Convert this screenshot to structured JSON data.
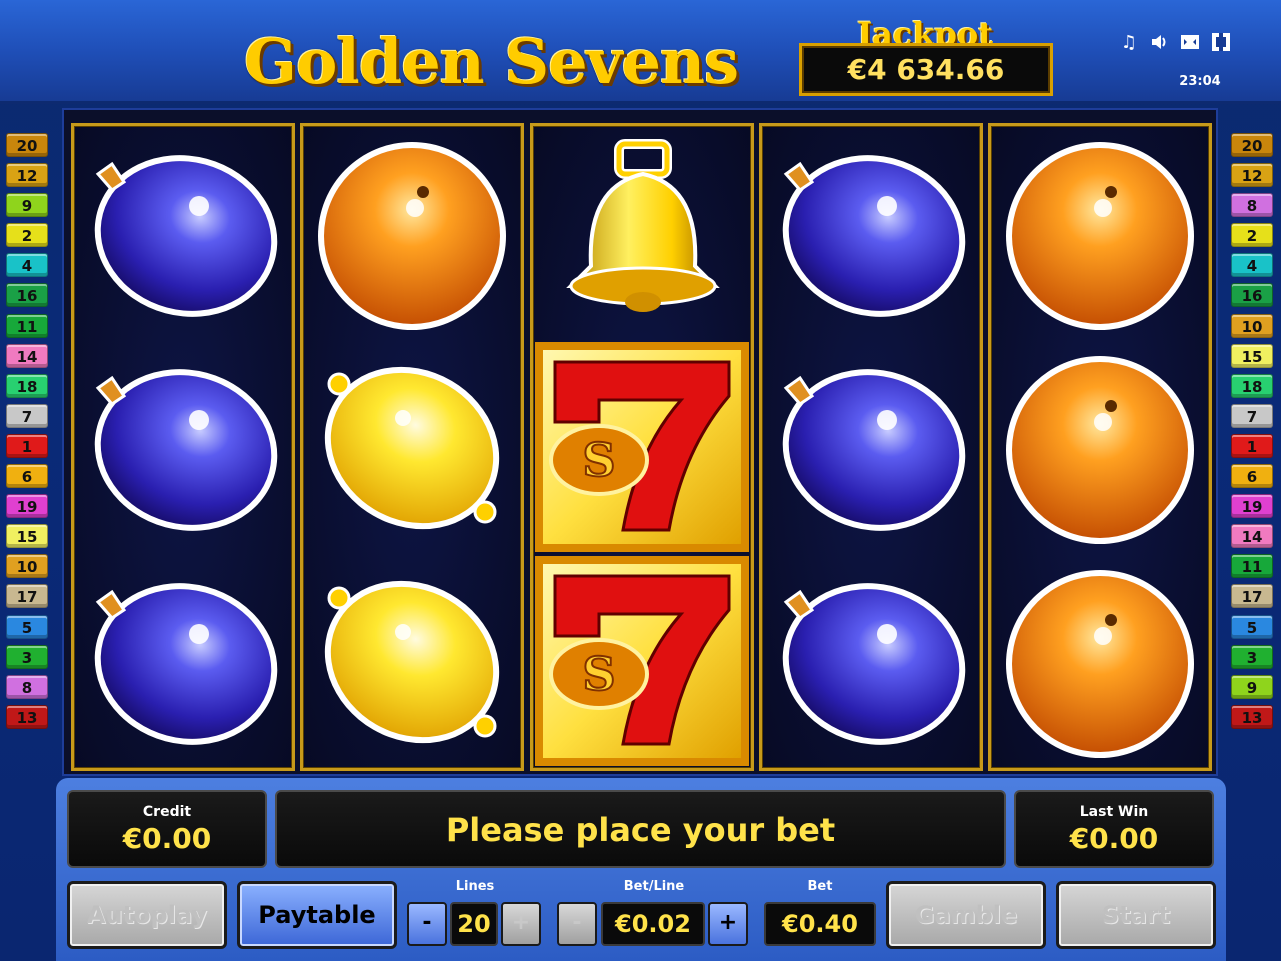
{
  "header": {
    "title": "Golden Sevens",
    "jackpot_label": "Jackpot",
    "jackpot_value": "€4 634.66",
    "clock": "23:04",
    "icons": [
      "music-icon",
      "speaker-icon",
      "fullscreen-icon",
      "settings-icon"
    ]
  },
  "paylines": {
    "left": [
      "20",
      "12",
      "9",
      "2",
      "4",
      "16",
      "11",
      "14",
      "18",
      "7",
      "1",
      "6",
      "19",
      "15",
      "10",
      "17",
      "5",
      "3",
      "8",
      "13"
    ],
    "right": [
      "20",
      "12",
      "8",
      "2",
      "4",
      "16",
      "10",
      "15",
      "18",
      "7",
      "1",
      "6",
      "19",
      "14",
      "11",
      "17",
      "5",
      "3",
      "9",
      "13"
    ],
    "colors": {
      "20": "#c9860c",
      "12": "#d9a214",
      "9": "#8fd41c",
      "2": "#e6e01a",
      "4": "#19c2c8",
      "16": "#1aa046",
      "11": "#17a83a",
      "14": "#f07ac0",
      "18": "#28d070",
      "7": "#c8c8c8",
      "1": "#e01a1a",
      "6": "#f0b010",
      "19": "#e040d0",
      "15": "#f0f060",
      "10": "#e0a020",
      "17": "#c8b890",
      "5": "#2a88e0",
      "3": "#20b030",
      "8": "#d070e0",
      "13": "#c01818"
    }
  },
  "reels": [
    [
      "plum",
      "plum",
      "plum"
    ],
    [
      "orange",
      "lemon",
      "lemon"
    ],
    [
      "bell",
      "seven",
      "seven"
    ],
    [
      "plum",
      "plum",
      "plum"
    ],
    [
      "orange",
      "orange",
      "orange"
    ]
  ],
  "panel": {
    "credit_label": "Credit",
    "credit_value": "€0.00",
    "message": "Please place your bet",
    "last_win_label": "Last Win",
    "last_win_value": "€0.00",
    "autoplay_label": "Autoplay",
    "paytable_label": "Paytable",
    "lines_label": "Lines",
    "lines_value": "20",
    "betline_label": "Bet/Line",
    "betline_value": "€0.02",
    "bet_label": "Bet",
    "bet_value": "€0.40",
    "gamble_label": "Gamble",
    "start_label": "Start",
    "minus": "-",
    "plus": "+"
  }
}
